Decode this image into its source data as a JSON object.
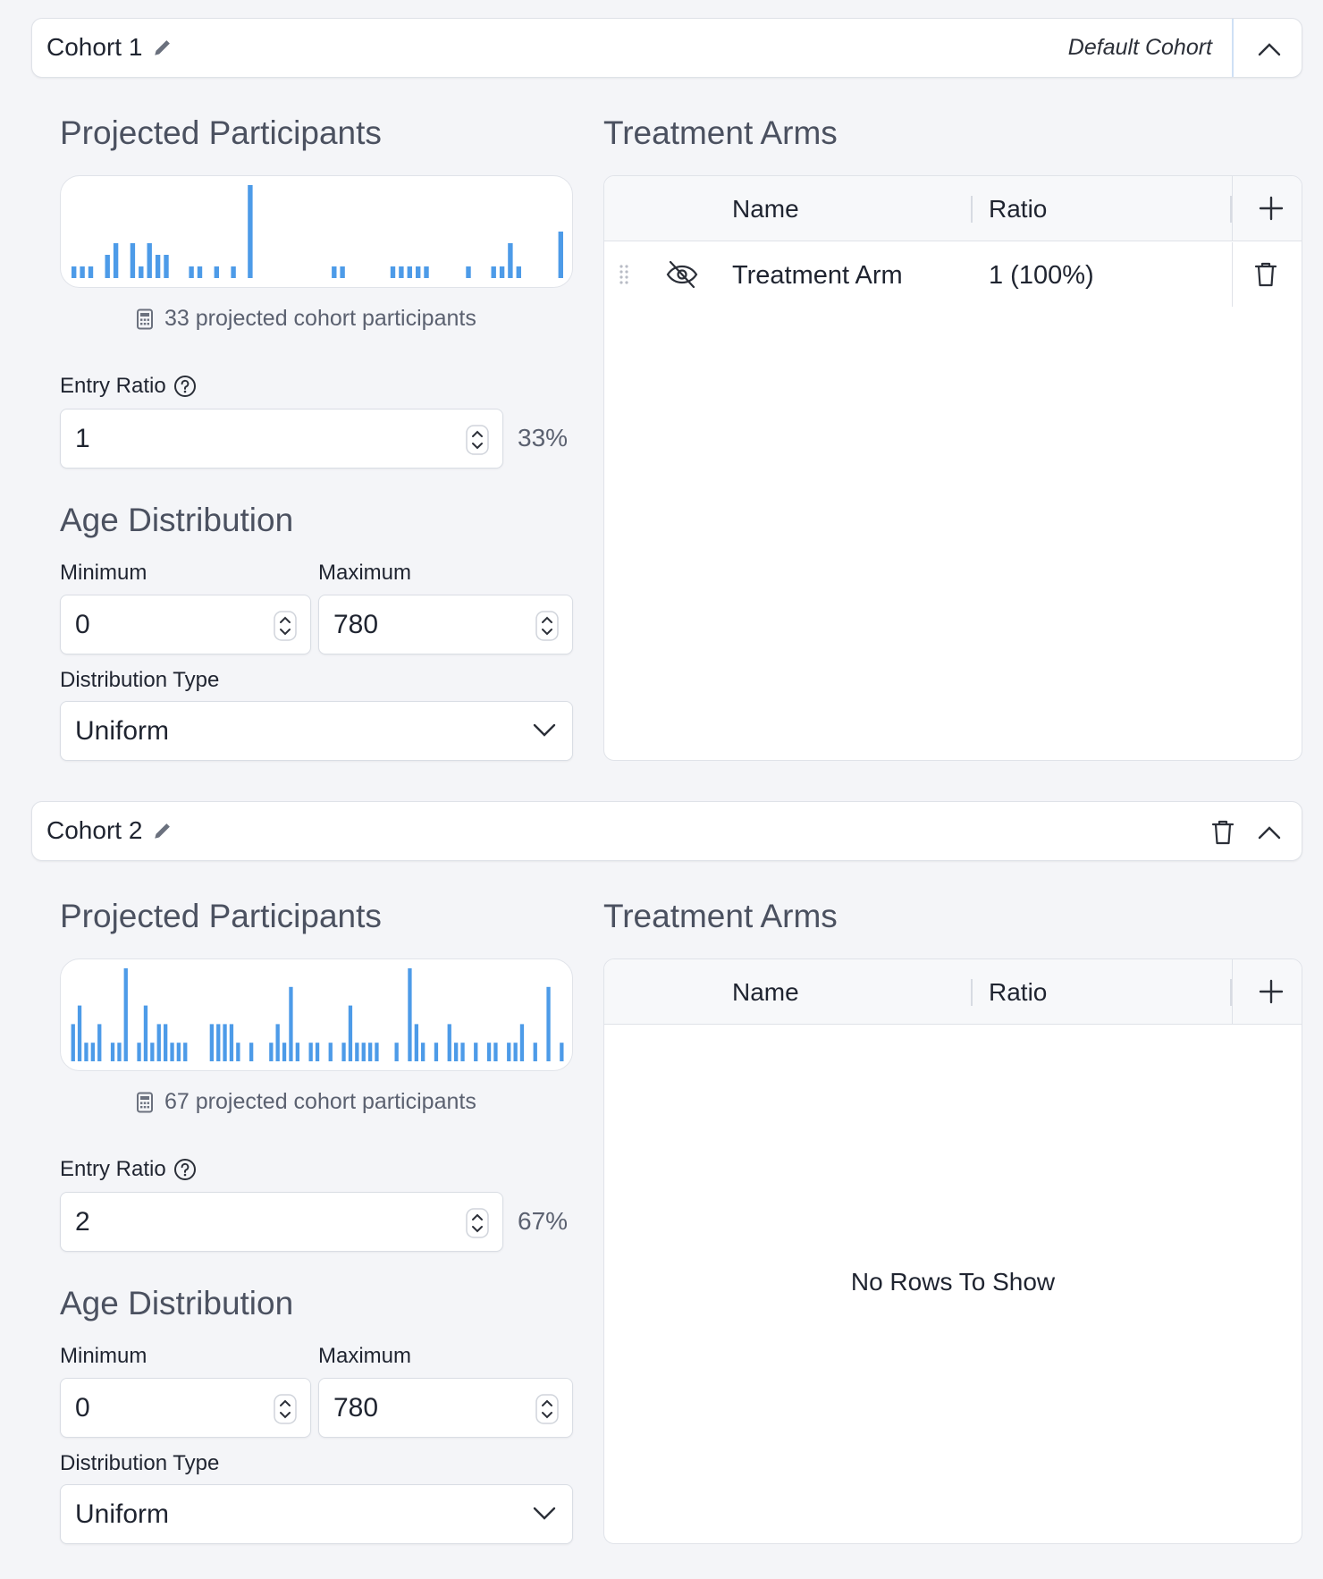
{
  "cohorts": [
    {
      "title": "Cohort 1",
      "default_label": "Default Cohort",
      "projected": {
        "heading": "Projected Participants",
        "text": "33 projected cohort participants"
      },
      "entry_ratio": {
        "label": "Entry Ratio",
        "value": "1",
        "percent": "33%"
      },
      "age": {
        "heading": "Age Distribution",
        "min_label": "Minimum",
        "min_value": "0",
        "max_label": "Maximum",
        "max_value": "780",
        "type_label": "Distribution Type",
        "type_value": "Uniform"
      },
      "arms": {
        "heading": "Treatment Arms",
        "col_name": "Name",
        "col_ratio": "Ratio",
        "rows": [
          {
            "name": "Treatment Arm",
            "ratio": "1 (100%)"
          }
        ]
      }
    },
    {
      "title": "Cohort 2",
      "projected": {
        "heading": "Projected Participants",
        "text": "67 projected cohort participants"
      },
      "entry_ratio": {
        "label": "Entry Ratio",
        "value": "2",
        "percent": "67%"
      },
      "age": {
        "heading": "Age Distribution",
        "min_label": "Minimum",
        "min_value": "0",
        "max_label": "Maximum",
        "max_value": "780",
        "type_label": "Distribution Type",
        "type_value": "Uniform"
      },
      "arms": {
        "heading": "Treatment Arms",
        "col_name": "Name",
        "col_ratio": "Ratio",
        "rows": [],
        "empty_text": "No Rows To Show"
      }
    }
  ],
  "colors": {
    "bar": "#4d9be8",
    "divider": "#cfe0f5"
  },
  "chart_data": [
    {
      "type": "bar",
      "values": [
        1,
        1,
        1,
        0,
        2,
        3,
        0,
        3,
        1,
        3,
        2,
        2,
        0,
        0,
        1,
        1,
        0,
        1,
        0,
        1,
        0,
        8,
        0,
        0,
        0,
        0,
        0,
        0,
        0,
        0,
        0,
        1,
        1,
        0,
        0,
        0,
        0,
        0,
        1,
        1,
        1,
        1,
        1,
        0,
        0,
        0,
        0,
        1,
        0,
        0,
        1,
        1,
        3,
        1,
        0,
        0,
        0,
        0,
        4
      ]
    },
    {
      "type": "bar",
      "values": [
        2,
        3,
        1,
        1,
        2,
        0,
        1,
        1,
        5,
        0,
        1,
        3,
        1,
        2,
        2,
        1,
        1,
        1,
        0,
        0,
        0,
        2,
        2,
        2,
        2,
        1,
        0,
        1,
        0,
        0,
        1,
        2,
        1,
        4,
        1,
        0,
        1,
        1,
        0,
        1,
        0,
        1,
        3,
        1,
        1,
        1,
        1,
        0,
        0,
        1,
        0,
        5,
        2,
        1,
        0,
        1,
        0,
        2,
        1,
        1,
        0,
        1,
        0,
        1,
        1,
        0,
        1,
        1,
        2,
        0,
        1,
        0,
        4,
        0,
        1
      ]
    }
  ]
}
